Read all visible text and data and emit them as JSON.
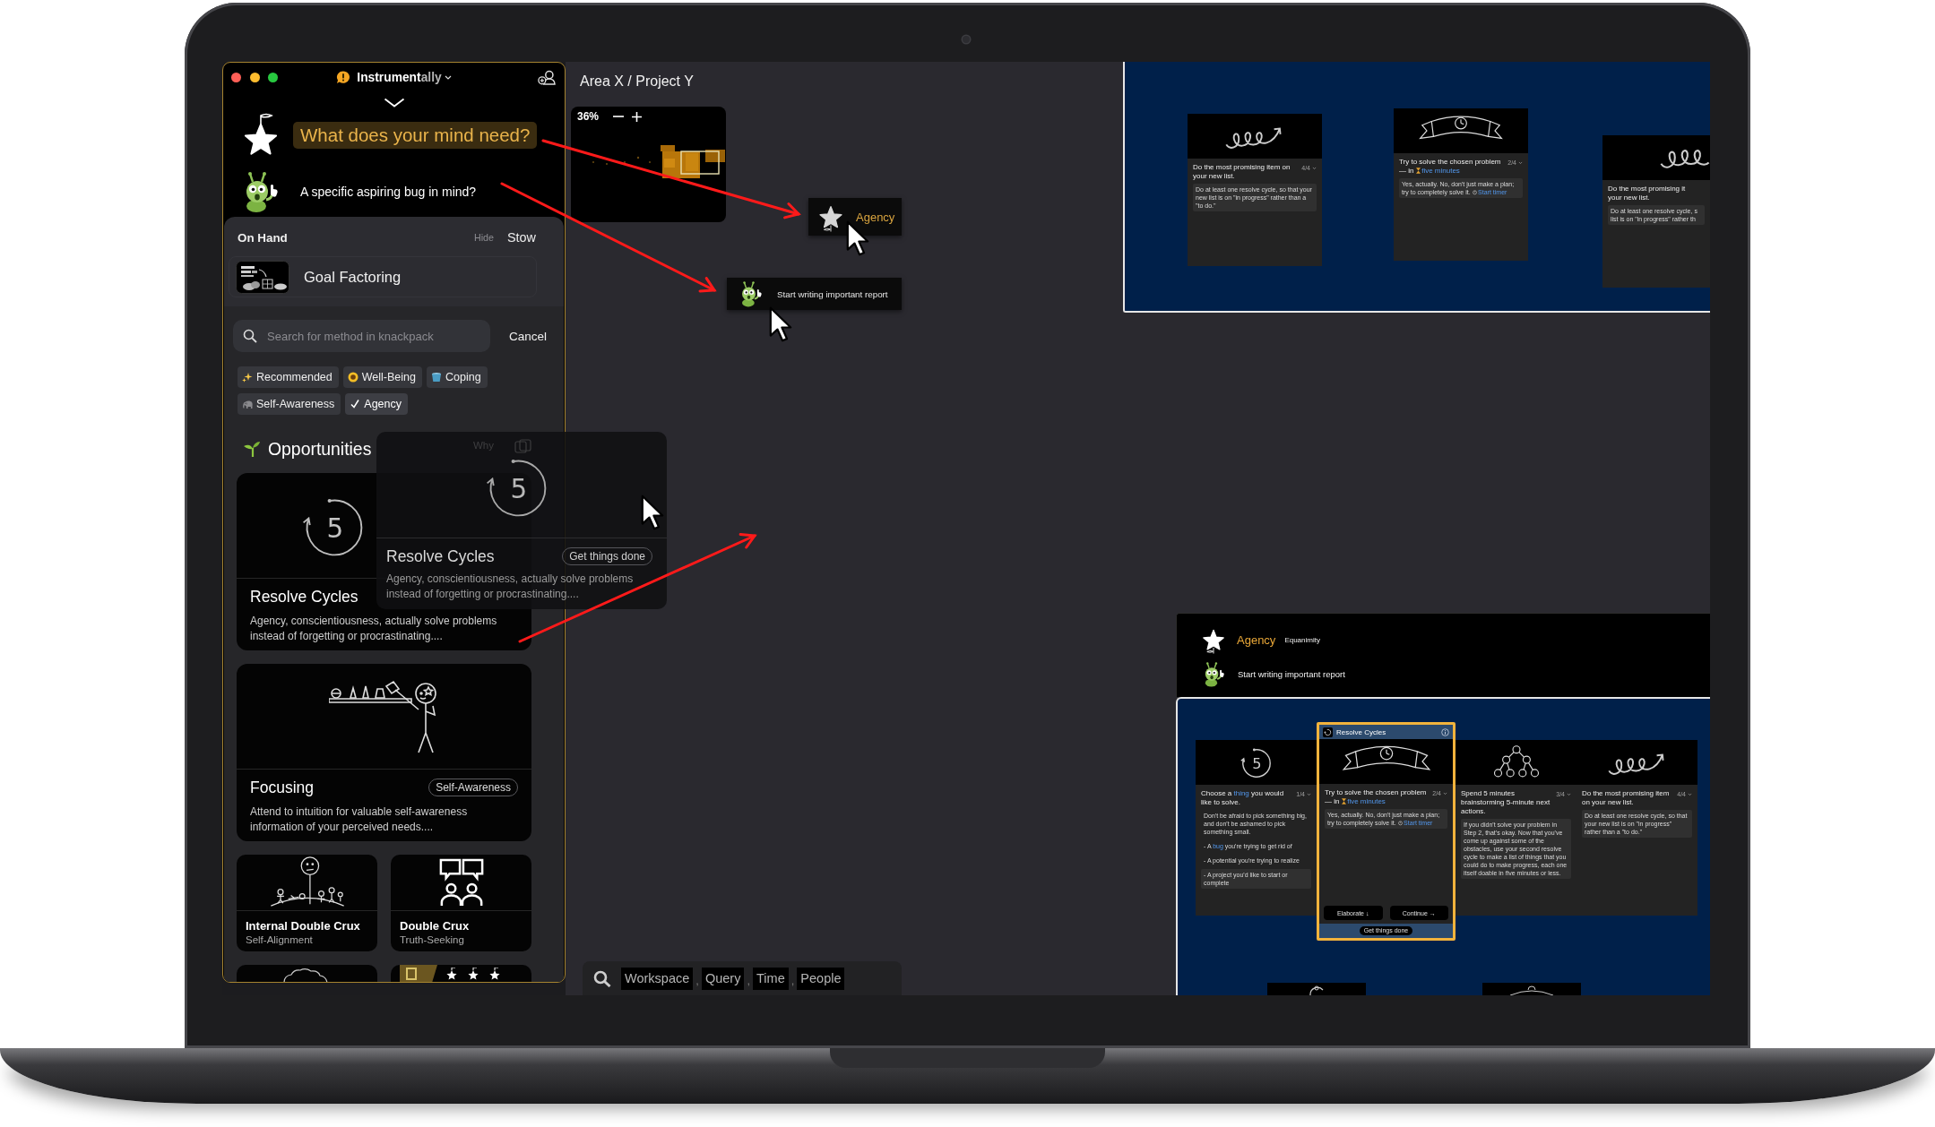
{
  "window": {
    "title": [
      {
        "text": "Instrument",
        "dim": false
      },
      {
        "text": "ally",
        "dim": true
      }
    ]
  },
  "prompts": [
    {
      "kind": "need",
      "text": "What does your mind need?",
      "selected": true
    },
    {
      "kind": "bug",
      "text": "A specific aspiring bug in mind?",
      "selected": false
    }
  ],
  "on_hand": {
    "title": "On Hand",
    "hide": "Hide",
    "stow": "Stow",
    "items": [
      {
        "label": "Goal Factoring"
      }
    ]
  },
  "search": {
    "placeholder": "Search for method in knackpack",
    "cancel": "Cancel"
  },
  "filters": [
    {
      "label": "Recommended",
      "selected": false
    },
    {
      "label": "Well-Being",
      "selected": false
    },
    {
      "label": "Coping",
      "selected": false
    },
    {
      "label": "Self-Awareness",
      "selected": false
    },
    {
      "label": "Agency",
      "selected": true
    }
  ],
  "opportunities": {
    "title": "Opportunities",
    "cards": [
      {
        "kind": "cycle",
        "figure": "5",
        "title": "Resolve Cycles",
        "desc": "Agency, conscientiousness, actually solve problems instead of forgetting or procrastinating...."
      },
      {
        "kind": "focusing",
        "title": "Focusing",
        "tag": "Self-Awareness",
        "desc": "Attend to intuition for valuable self-awareness information of your perceived needs...."
      },
      {
        "kind": "inner_crux",
        "title": "Internal Double Crux",
        "subtitle": "Self-Alignment"
      },
      {
        "kind": "double_crux",
        "title": "Double Crux",
        "subtitle": "Truth-Seeking"
      }
    ]
  },
  "drag_preview": {
    "why": "Why",
    "figure": "5",
    "title": "Resolve Cycles",
    "tag": "Get things done",
    "desc": "Agency, conscientiousness, actually solve problems instead of forgetting or procrastinating...."
  },
  "breadcrumb": "Area X / Project Y",
  "minimap": {
    "zoom": "36%"
  },
  "canvas_nodes": [
    {
      "kind": "need",
      "label": "Agency"
    },
    {
      "kind": "bug",
      "label": "Start writing important report"
    }
  ],
  "workspace": {
    "cards": [
      {
        "kind": "spiral",
        "step": "4/4",
        "title": [
          {
            "text": "Do the most promising item on your new list."
          }
        ],
        "notes": [
          {
            "text": [
              {
                "text": "Do at least one resolve cycle, so that your new list is on \"in progress\" rather than a \"to do.\""
              }
            ],
            "boxed": true
          }
        ]
      },
      {
        "kind": "banner",
        "step": "2/4",
        "title": [
          {
            "text": "Try to solve the chosen problem — in "
          },
          {
            "text": "five minutes",
            "kind": "duration"
          }
        ],
        "notes": [
          {
            "text": [
              {
                "text": "Yes, actually. No, don't just make a plan; try to completely solve it. "
              },
              {
                "text": "Start timer",
                "kind": "timer"
              }
            ],
            "boxed": true
          }
        ]
      },
      {
        "kind": "spiral",
        "title_lines": [
          "Do the most promising it",
          "your new list."
        ],
        "note_lines": [
          "Do at least one resolve cycle, s",
          "list is on \"in progress\" rather th"
        ]
      }
    ]
  },
  "focus_view": {
    "need": "Agency",
    "need_tag": "Equanimity",
    "bug": "Start writing important report",
    "active": {
      "title": "Resolve Cycles",
      "buttons": [
        "Elaborate ↓",
        "Continue →"
      ],
      "tag": "Get things done"
    },
    "steps": [
      {
        "kind": "cycle",
        "figure": "5",
        "step": "1/4",
        "selected": false,
        "title": [
          {
            "text": "Choose a "
          },
          {
            "text": "thing",
            "kind": "link"
          },
          {
            "text": " you would like to solve."
          }
        ],
        "notes": [
          {
            "text": [
              {
                "text": "Don't be afraid to pick something big, and don't be ashamed to pick something small."
              }
            ],
            "boxed": false
          },
          {
            "text": [
              {
                "text": "- A "
              },
              {
                "text": "bug",
                "kind": "link"
              },
              {
                "text": " you're trying to get rid of"
              }
            ],
            "boxed": false
          },
          {
            "text": [
              {
                "text": "- A potential you're trying to realize"
              }
            ],
            "boxed": false
          },
          {
            "text": [
              {
                "text": "- A project you'd like to start or complete"
              }
            ],
            "boxed": true
          }
        ]
      },
      {
        "kind": "banner",
        "step": "2/4",
        "selected": true,
        "title": [
          {
            "text": "Try to solve the chosen problem — in "
          },
          {
            "text": "five minutes",
            "kind": "duration"
          }
        ],
        "notes": [
          {
            "text": [
              {
                "text": "Yes, actually. No, don't just make a plan; try to completely solve it. "
              },
              {
                "text": "Start timer",
                "kind": "timer"
              }
            ],
            "boxed": true
          }
        ]
      },
      {
        "kind": "tree",
        "step": "3/4",
        "selected": false,
        "title": [
          {
            "text": "Spend 5 minutes brainstorming 5-minute next actions."
          }
        ],
        "notes": [
          {
            "text": [
              {
                "text": "If you didn't solve your problem in Step 2, that's okay. Now that you've come up against some of the obstacles, use your second resolve cycle to make a list of things that you could do to make progress, each one itself doable in five minutes or less."
              }
            ],
            "boxed": true
          }
        ]
      },
      {
        "kind": "spiral",
        "step": "4/4",
        "selected": false,
        "title": [
          {
            "text": "Do the most promising item on your new list."
          }
        ],
        "notes": [
          {
            "text": [
              {
                "text": "Do at least one resolve cycle, so that your new list is on \"in progress\" rather than a \"to do.\""
              }
            ],
            "boxed": true
          }
        ]
      }
    ]
  },
  "query_bar": {
    "items": [
      {
        "kind": "token",
        "text": "Workspace"
      },
      {
        "kind": "separator",
        "text": ","
      },
      {
        "kind": "token",
        "text": "Query"
      },
      {
        "kind": "separator",
        "text": ","
      },
      {
        "kind": "token",
        "text": "Time"
      },
      {
        "kind": "separator",
        "text": ","
      },
      {
        "kind": "token",
        "text": "People"
      }
    ]
  }
}
